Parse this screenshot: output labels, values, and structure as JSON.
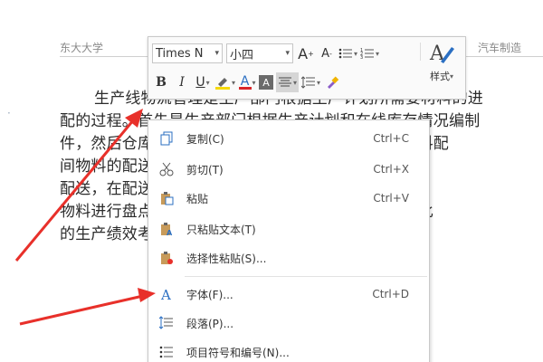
{
  "document": {
    "header_left": "东大大学",
    "header_right": "汽车制造",
    "side_mark": "·",
    "lines": [
      "生产线物流管理是生产部门根据生产计划所需要材料的进",
      "配的过程。首先是生产部门根据生产计划和在线库存情况编制",
      "件，然后仓库管理员根据领料单进行库存盘点生成物料配",
      "间物料的配送，同时生产部门根据实际库存情况进行",
      "配送，在配送过程中，对物料进行验收，在生产活动",
      "物料进行盘点，同时物料计划部门进行财务核算，以此",
      "的生产绩效考核。"
    ]
  },
  "toolbar": {
    "font_name": "Times N",
    "font_size": "小四",
    "grow_font": "A",
    "shrink_font": "A",
    "bold": "B",
    "italic": "I",
    "underline": "U",
    "font_color_letter": "A",
    "char_shading_letter": "A",
    "style_label": "样式"
  },
  "context_menu": {
    "items": [
      {
        "label": "复制(C)",
        "shortcut": "Ctrl+C",
        "icon": "copy-icon"
      },
      {
        "label": "剪切(T)",
        "shortcut": "Ctrl+X",
        "icon": "scissors-icon"
      },
      {
        "label": "粘贴",
        "shortcut": "Ctrl+V",
        "icon": "paste-icon"
      },
      {
        "label": "只粘贴文本(T)",
        "shortcut": "",
        "icon": "paste-text-icon"
      },
      {
        "label": "选择性粘贴(S)...",
        "shortcut": "",
        "icon": "paste-special-icon"
      },
      {
        "label": "字体(F)...",
        "shortcut": "Ctrl+D",
        "icon": "font-icon"
      },
      {
        "label": "段落(P)...",
        "shortcut": "",
        "icon": "paragraph-icon"
      },
      {
        "label": "项目符号和编号(N)...",
        "shortcut": "",
        "icon": "bullets-numbering-icon"
      }
    ]
  },
  "colors": {
    "accent_blue": "#2b6fc2",
    "arrow_red": "#e8302a",
    "highlight_yellow": "#f5d90a",
    "font_color_red": "#d9262a"
  }
}
